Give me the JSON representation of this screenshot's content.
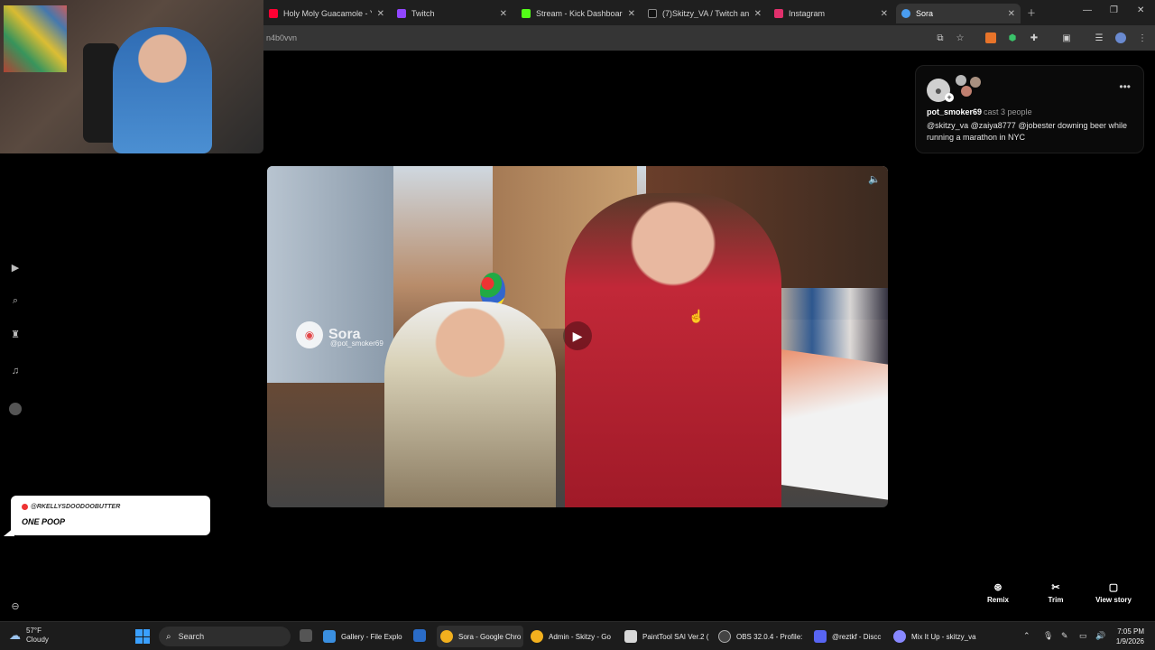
{
  "browser": {
    "tabs": [
      {
        "label": "Holy Moly Guacamole - Y",
        "color": "#ff0033"
      },
      {
        "label": "Twitch",
        "color": "#9146ff"
      },
      {
        "label": "Stream - Kick Dashboard",
        "color": "#53fc18"
      },
      {
        "label": "(7)Skitzy_VA / Twitch and",
        "color": "#111111"
      },
      {
        "label": "Instagram",
        "color": "#e1306c"
      },
      {
        "label": "Sora",
        "color": "#4a9df0"
      }
    ],
    "url": "n4b0vvn"
  },
  "post": {
    "username": "pot_smoker69",
    "cast_text": "cast 3 people",
    "caption": "@skitzy_va @zaiya8777 @jobester downing beer while running a marathon in NYC",
    "watermark_brand": "Sora",
    "watermark_handle": "@pot_smoker69"
  },
  "actions": {
    "remix": "Remix",
    "trim": "Trim",
    "view_story": "View story"
  },
  "chat": {
    "user": "@RKELLYSDOODOOBUTTER",
    "message": "ONE POOP"
  },
  "taskbar": {
    "temperature": "57°F",
    "condition": "Cloudy",
    "search": "Search",
    "apps": [
      {
        "label": "Gallery - File Explo",
        "color": "#3a8fe0"
      },
      {
        "label": "Sora - Google Chro",
        "color": "#f2b01e"
      },
      {
        "label": "Admin - Skitzy - Go",
        "color": "#f2b01e"
      },
      {
        "label": "PaintTool SAI Ver.2 (",
        "color": "#d8d8d8"
      },
      {
        "label": "OBS 32.0.4 - Profile:",
        "color": "#444444"
      },
      {
        "label": "@reztkf - Discc",
        "color": "#5865f2"
      },
      {
        "label": "Mix It Up - skitzy_va",
        "color": "#8888ff"
      }
    ],
    "time": "7:05 PM",
    "date": "1/9/2026"
  }
}
